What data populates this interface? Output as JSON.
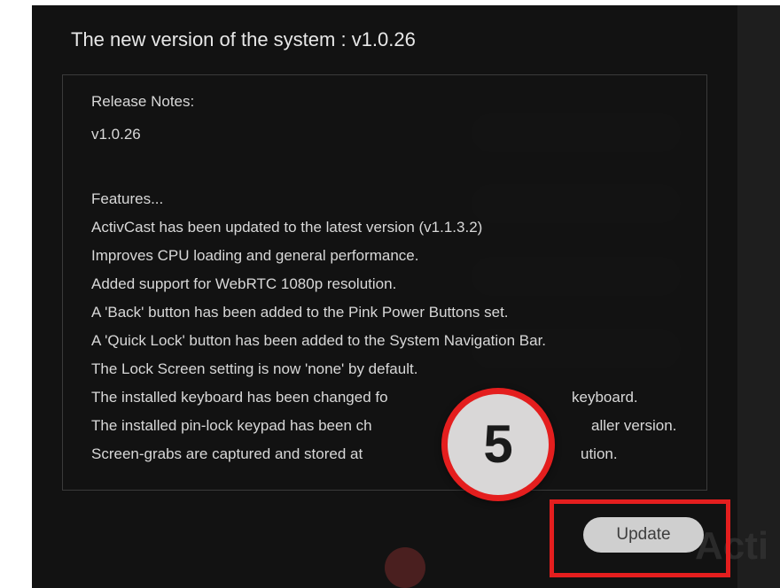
{
  "dialog": {
    "title": "The new version of the system :  v1.0.26",
    "release_notes": [
      "Release Notes:",
      "v1.0.26",
      "",
      "Features...",
      "ActivCast has been updated to the latest version (v1.1.3.2)",
      "Improves CPU loading and general performance.",
      "Added support for WebRTC 1080p resolution.",
      "A 'Back' button has been added to the Pink Power Buttons set.",
      "A 'Quick Lock' button has been added to the System Navigation Bar.",
      "The Lock Screen setting is now 'none' by default.",
      "The installed keyboard has been changed fo",
      "The installed pin-lock keypad has been ch",
      "Screen-grabs are captured and stored at"
    ],
    "release_notes_tails": [
      "keyboard.",
      "aller version.",
      "ution."
    ],
    "update_label": "Update"
  },
  "annotation": {
    "step_number": "5",
    "highlight_color": "#e41e1e"
  },
  "background": {
    "watermark": "Acti"
  }
}
